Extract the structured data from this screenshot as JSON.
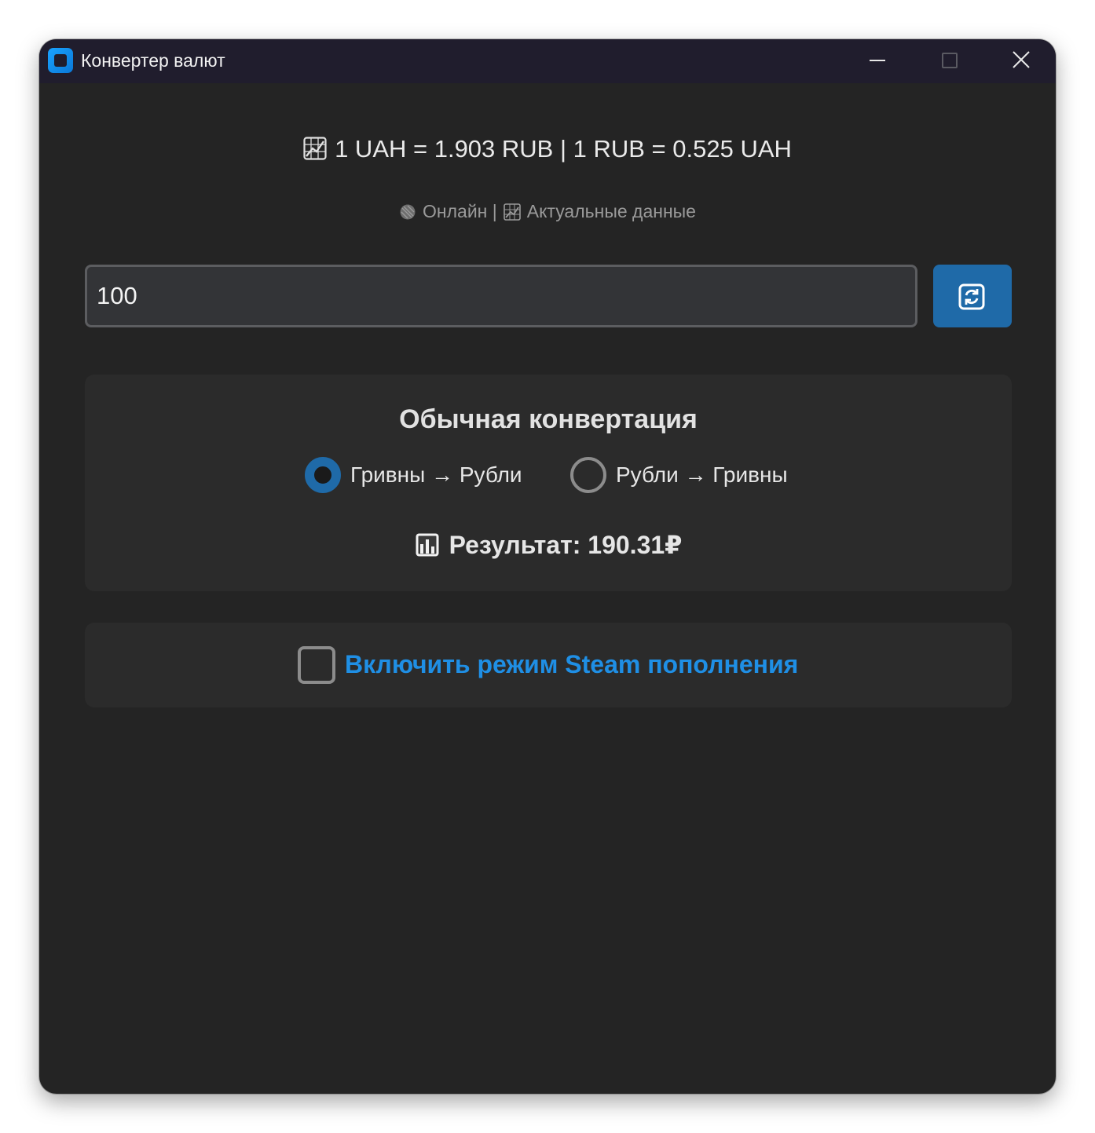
{
  "window": {
    "title": "Конвертер валют"
  },
  "rates": {
    "text": "1 UAH = 1.903 RUB | 1 RUB = 0.525 UAH",
    "icon": "chart-increasing-icon"
  },
  "status": {
    "online_label": "Онлайн |",
    "data_label": "Актуальные данные",
    "online_icon": "globe-icon",
    "data_icon": "chart-icon"
  },
  "amount": {
    "value": "100"
  },
  "swap_button": {
    "icon": "swap-arrows-icon"
  },
  "normal_mode": {
    "title": "Обычная конвертация",
    "options": [
      {
        "label": "Гривны → Рубли",
        "selected": true
      },
      {
        "label": "Рубли → Гривны",
        "selected": false
      }
    ],
    "result_label": "Результат: 190.31₽",
    "result_icon": "bar-chart-icon"
  },
  "steam_mode": {
    "label": "Включить режим Steam пополнения",
    "checked": false
  },
  "colors": {
    "accent": "#1f6aa8",
    "link": "#1f8fe5",
    "background": "#242424",
    "card": "#2b2b2b",
    "titlebar": "#201d2d"
  }
}
